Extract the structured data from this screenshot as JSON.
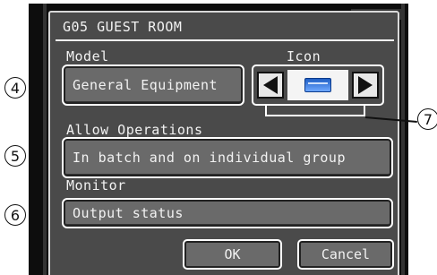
{
  "title": "G05 GUEST ROOM",
  "model": {
    "label": "Model",
    "value": "General Equipment"
  },
  "icon": {
    "label": "Icon",
    "left_arrow": "◀",
    "right_arrow": "▶",
    "preview_icon": "equipment-icon"
  },
  "allow_operations": {
    "label": "Allow Operations",
    "value": "In batch and on individual group"
  },
  "monitor": {
    "label": "Monitor",
    "value": "Output status"
  },
  "buttons": {
    "ok": "OK",
    "cancel": "Cancel"
  },
  "callouts": {
    "c4": "4",
    "c5": "5",
    "c6": "6",
    "c7": "7"
  },
  "colors": {
    "panel": "#4a4a4a",
    "button": "#6a6a6a",
    "frame": "#0d0d0d",
    "icon_blue": "#1f5fc4"
  }
}
